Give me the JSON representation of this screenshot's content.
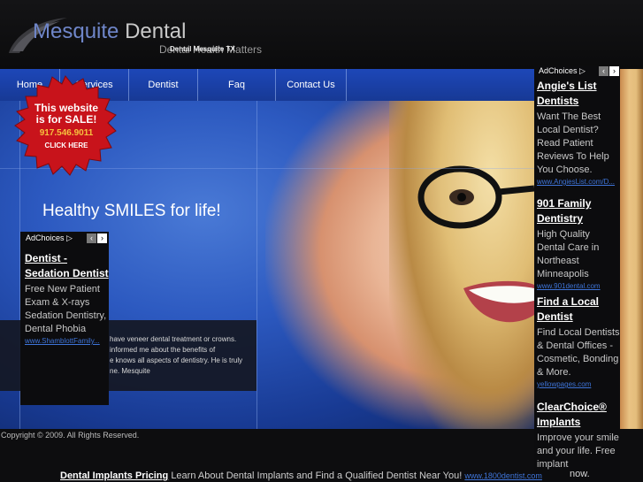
{
  "header": {
    "logo_part1": "Mesquite",
    "logo_part2": "Dental",
    "tagline": "Dental Health Matters",
    "site_heading": "Dental Mesquite TX"
  },
  "nav": {
    "items": [
      {
        "label": "Home"
      },
      {
        "label": "Services"
      },
      {
        "label": "Dentist"
      },
      {
        "label": "Faq"
      },
      {
        "label": "Contact Us"
      }
    ]
  },
  "hero": {
    "headline": "Healthy SMILES for life!"
  },
  "testimonial": {
    "lines": [
      "have veneer dental treatment or crowns.",
      "informed me about the benefits of",
      "e knows all aspects of dentistry. He is truly",
      "ne. Mesquite"
    ]
  },
  "sale_badge": {
    "line1": "This website",
    "line2": "is for SALE!",
    "phone": "917.546.9011",
    "cta": "CLICK HERE"
  },
  "ad_left": {
    "adchoices_label": "AdChoices",
    "title": "Dentist - Sedation Dentist",
    "description": "Free New Patient Exam & X-rays Sedation Dentistry, Dental Phobia",
    "url": "www.ShamblottFamily..."
  },
  "ad_right": {
    "adchoices_label": "AdChoices",
    "ads": [
      {
        "title": "Angie's List Dentists",
        "description": "Want The Best Local Dentist? Read Patient Reviews To Help You Choose.",
        "url": "www.AngiesList.com/D..."
      },
      {
        "title": "901 Family Dentistry",
        "description": "High Quality Dental Care in Northeast Minneapolis",
        "url": "www.901dental.com"
      },
      {
        "title": "Find a Local Dentist",
        "description": "Find Local Dentists & Dental Offices - Cosmetic, Bonding & More.",
        "url": "yellowpages.com"
      },
      {
        "title": "ClearChoice® Implants",
        "description": "Improve your smile and your life. Free implant",
        "url": ""
      }
    ],
    "trailing_text": "now."
  },
  "footer": {
    "copyright": "Copyright © 2009. All Rights Reserved.",
    "bottom_ad_title": "Dental Implants Pricing",
    "bottom_ad_desc": "Learn About Dental Implants and Find a Qualified Dentist Near You!",
    "bottom_ad_url": "www.1800dentist.com"
  },
  "colors": {
    "accent_blue": "#2c59c0",
    "logo_blue": "#6f86c9",
    "link_blue": "#3e74d8",
    "badge_red": "#c8131b",
    "badge_gold": "#f6c23e"
  }
}
